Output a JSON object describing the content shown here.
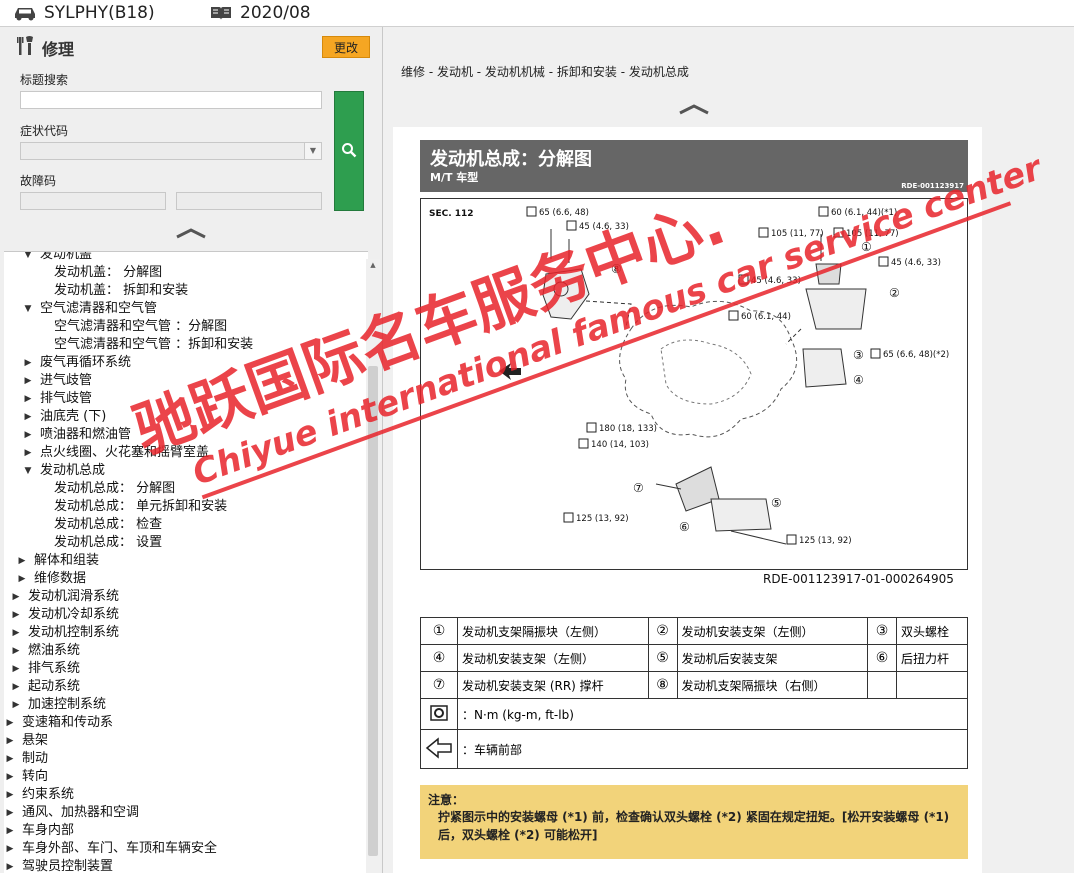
{
  "topbar": {
    "model": "SYLPHY(B18)",
    "date": "2020/08",
    "car_icon": "car-icon",
    "book_icon": "book-icon"
  },
  "left_panel": {
    "title": "修理",
    "change_button": "更改",
    "title_search_label": "标题搜索",
    "title_search_value": "",
    "symptom_code_label": "症状代码",
    "symptom_code_value": "",
    "fault_code_label": "故障码",
    "fault_code_value_1": "",
    "fault_code_value_2": "",
    "collapse_icon": "chevron-up-icon",
    "search_icon": "search-icon"
  },
  "tree": {
    "items": [
      {
        "label": "发动机盖",
        "level": 2,
        "expanded": true
      },
      {
        "label": "发动机盖： 分解图",
        "level": 3
      },
      {
        "label": "发动机盖： 拆卸和安装",
        "level": 3
      },
      {
        "label": "空气滤清器和空气管",
        "level": 2,
        "expanded": true
      },
      {
        "label": "空气滤清器和空气管 ：分解图",
        "level": 3
      },
      {
        "label": "空气滤清器和空气管 ：拆卸和安装",
        "level": 3
      },
      {
        "label": "废气再循环系统",
        "level": 2,
        "expanded": false
      },
      {
        "label": "进气歧管",
        "level": 2,
        "expanded": false
      },
      {
        "label": "排气歧管",
        "level": 2,
        "expanded": false
      },
      {
        "label": "油底壳 (下)",
        "level": 2,
        "expanded": false
      },
      {
        "label": "喷油器和燃油管",
        "level": 2,
        "expanded": false
      },
      {
        "label": "点火线圈、火花塞和摇臂室盖",
        "level": 2,
        "expanded": false
      },
      {
        "label": "发动机总成",
        "level": 2,
        "expanded": true
      },
      {
        "label": "发动机总成： 分解图",
        "level": 3
      },
      {
        "label": "发动机总成： 单元拆卸和安装",
        "level": 3
      },
      {
        "label": "发动机总成： 检查",
        "level": 3
      },
      {
        "label": "发动机总成： 设置",
        "level": 3
      },
      {
        "label": "解体和组装",
        "level": "1b",
        "expanded": false
      },
      {
        "label": "维修数据",
        "level": "1b",
        "expanded": false
      },
      {
        "label": "发动机润滑系统",
        "level": 1,
        "expanded": false
      },
      {
        "label": "发动机冷却系统",
        "level": 1,
        "expanded": false
      },
      {
        "label": "发动机控制系统",
        "level": 1,
        "expanded": false
      },
      {
        "label": "燃油系统",
        "level": 1,
        "expanded": false
      },
      {
        "label": "排气系统",
        "level": 1,
        "expanded": false
      },
      {
        "label": "起动系统",
        "level": 1,
        "expanded": false
      },
      {
        "label": "加速控制系统",
        "level": 1,
        "expanded": false
      },
      {
        "label": "变速箱和传动系",
        "level": 0,
        "expanded": false
      },
      {
        "label": "悬架",
        "level": 0,
        "expanded": false
      },
      {
        "label": "制动",
        "level": 0,
        "expanded": false
      },
      {
        "label": "转向",
        "level": 0,
        "expanded": false
      },
      {
        "label": "约束系统",
        "level": 0,
        "expanded": false
      },
      {
        "label": "通风、加热器和空调",
        "level": 0,
        "expanded": false
      },
      {
        "label": "车身内部",
        "level": 0,
        "expanded": false
      },
      {
        "label": "车身外部、车门、车顶和车辆安全",
        "level": 0,
        "expanded": false
      },
      {
        "label": "驾驶员控制装置",
        "level": 0,
        "expanded": false
      }
    ]
  },
  "main": {
    "breadcrumb": "维修 - 发动机 - 发动机机械 - 拆卸和安装 - 发动机总成",
    "collapse_icon": "chevron-up-icon",
    "doc": {
      "title": "发动机总成：分解图",
      "subtitle": "M/T 车型",
      "ref": "RDE-001123917",
      "figure_code": "RDE-001123917-01-000264905",
      "figure": {
        "sec": "SEC. 112",
        "torques": [
          {
            "text": "65 (6.6, 48)"
          },
          {
            "text": "45 (4.6, 33)"
          },
          {
            "text": "60 (6.1, 44)(*1)"
          },
          {
            "text": "105 (11, 77)"
          },
          {
            "text": "105 (11, 77)"
          },
          {
            "text": "45 (4.6, 33)"
          },
          {
            "text": "45 (4.6, 33)"
          },
          {
            "text": "60 (6.1, 44)"
          },
          {
            "text": "65 (6.6, 48)(*2)"
          },
          {
            "text": "180 (18, 133)"
          },
          {
            "text": "140 (14, 103)"
          },
          {
            "text": "125 (13, 92)"
          },
          {
            "text": "125 (13, 92)"
          }
        ],
        "callouts": [
          "①",
          "②",
          "③",
          "④",
          "⑤",
          "⑥",
          "⑦",
          "⑧"
        ]
      },
      "legend": [
        [
          {
            "num": "①",
            "text": "发动机支架隔振块（左侧）"
          },
          {
            "num": "②",
            "text": "发动机安装支架（左侧）"
          },
          {
            "num": "③",
            "text": "双头螺栓"
          }
        ],
        [
          {
            "num": "④",
            "text": "发动机安装支架（左侧）"
          },
          {
            "num": "⑤",
            "text": "发动机后安装支架"
          },
          {
            "num": "⑥",
            "text": "后扭力杆"
          }
        ],
        [
          {
            "num": "⑦",
            "text": "发动机安装支架 (RR) 撑杆"
          },
          {
            "num": "⑧",
            "text": "发动机支架隔振块（右侧）"
          },
          {
            "num": "",
            "text": ""
          }
        ]
      ],
      "torque_symbol_text": "：N·m (kg-m, ft-lb)",
      "front_symbol_text": "：车辆前部",
      "note_title": "注意：",
      "note_text": "拧紧图示中的安装螺母 (*1) 前，检查确认双头螺栓 (*2) 紧固在规定扭矩。[松开安装螺母 (*1) 后，双头螺栓 (*2) 可能松开]"
    }
  },
  "watermark": {
    "cn": "驰跃国际名车服务中心.",
    "en": "Chiyue international famous car service center",
    "color": "#e8232a"
  }
}
